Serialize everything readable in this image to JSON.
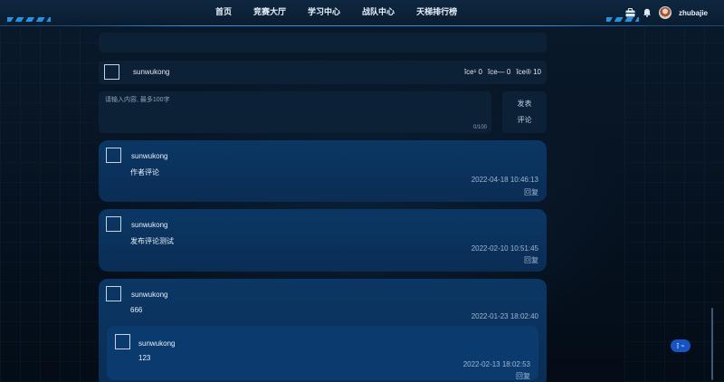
{
  "nav": {
    "items": [
      "首页",
      "竞赛大厅",
      "学习中心",
      "战队中心",
      "天梯排行榜"
    ]
  },
  "user": {
    "name": "zhubajie"
  },
  "post": {
    "author": "sunwukong",
    "stats": [
      "îce¹ 0",
      "îce— 0",
      "îce® 10"
    ]
  },
  "compose": {
    "placeholder": "请输入内容, 最多100字",
    "counter": "0/100",
    "publish_line1": "发表",
    "publish_line2": "评论"
  },
  "comments": [
    {
      "author": "sunwukong",
      "text": "作者评论",
      "time": "2022-04-18 10:46:13",
      "reply": "回复"
    },
    {
      "author": "sunwukong",
      "text": "发布评论测试",
      "time": "2022-02-10 10:51:45",
      "reply": "回复"
    },
    {
      "author": "sunwukong",
      "text": "666",
      "time": "2022-01-23 18:02:40",
      "replies": [
        {
          "author": "sunwukong",
          "text": "123",
          "time": "2022-02-13 18:02:53",
          "reply": "回复"
        }
      ]
    }
  ],
  "float_button": {
    "label": "î",
    "mark": "™"
  },
  "colors": {
    "accent": "#2aa7ff",
    "card": "#0b3765",
    "panel": "#0c2036",
    "background": "#07121f"
  },
  "icons": {
    "toolbox": "briefcase-icon",
    "bell": "bell-icon",
    "avatar": "avatar"
  }
}
